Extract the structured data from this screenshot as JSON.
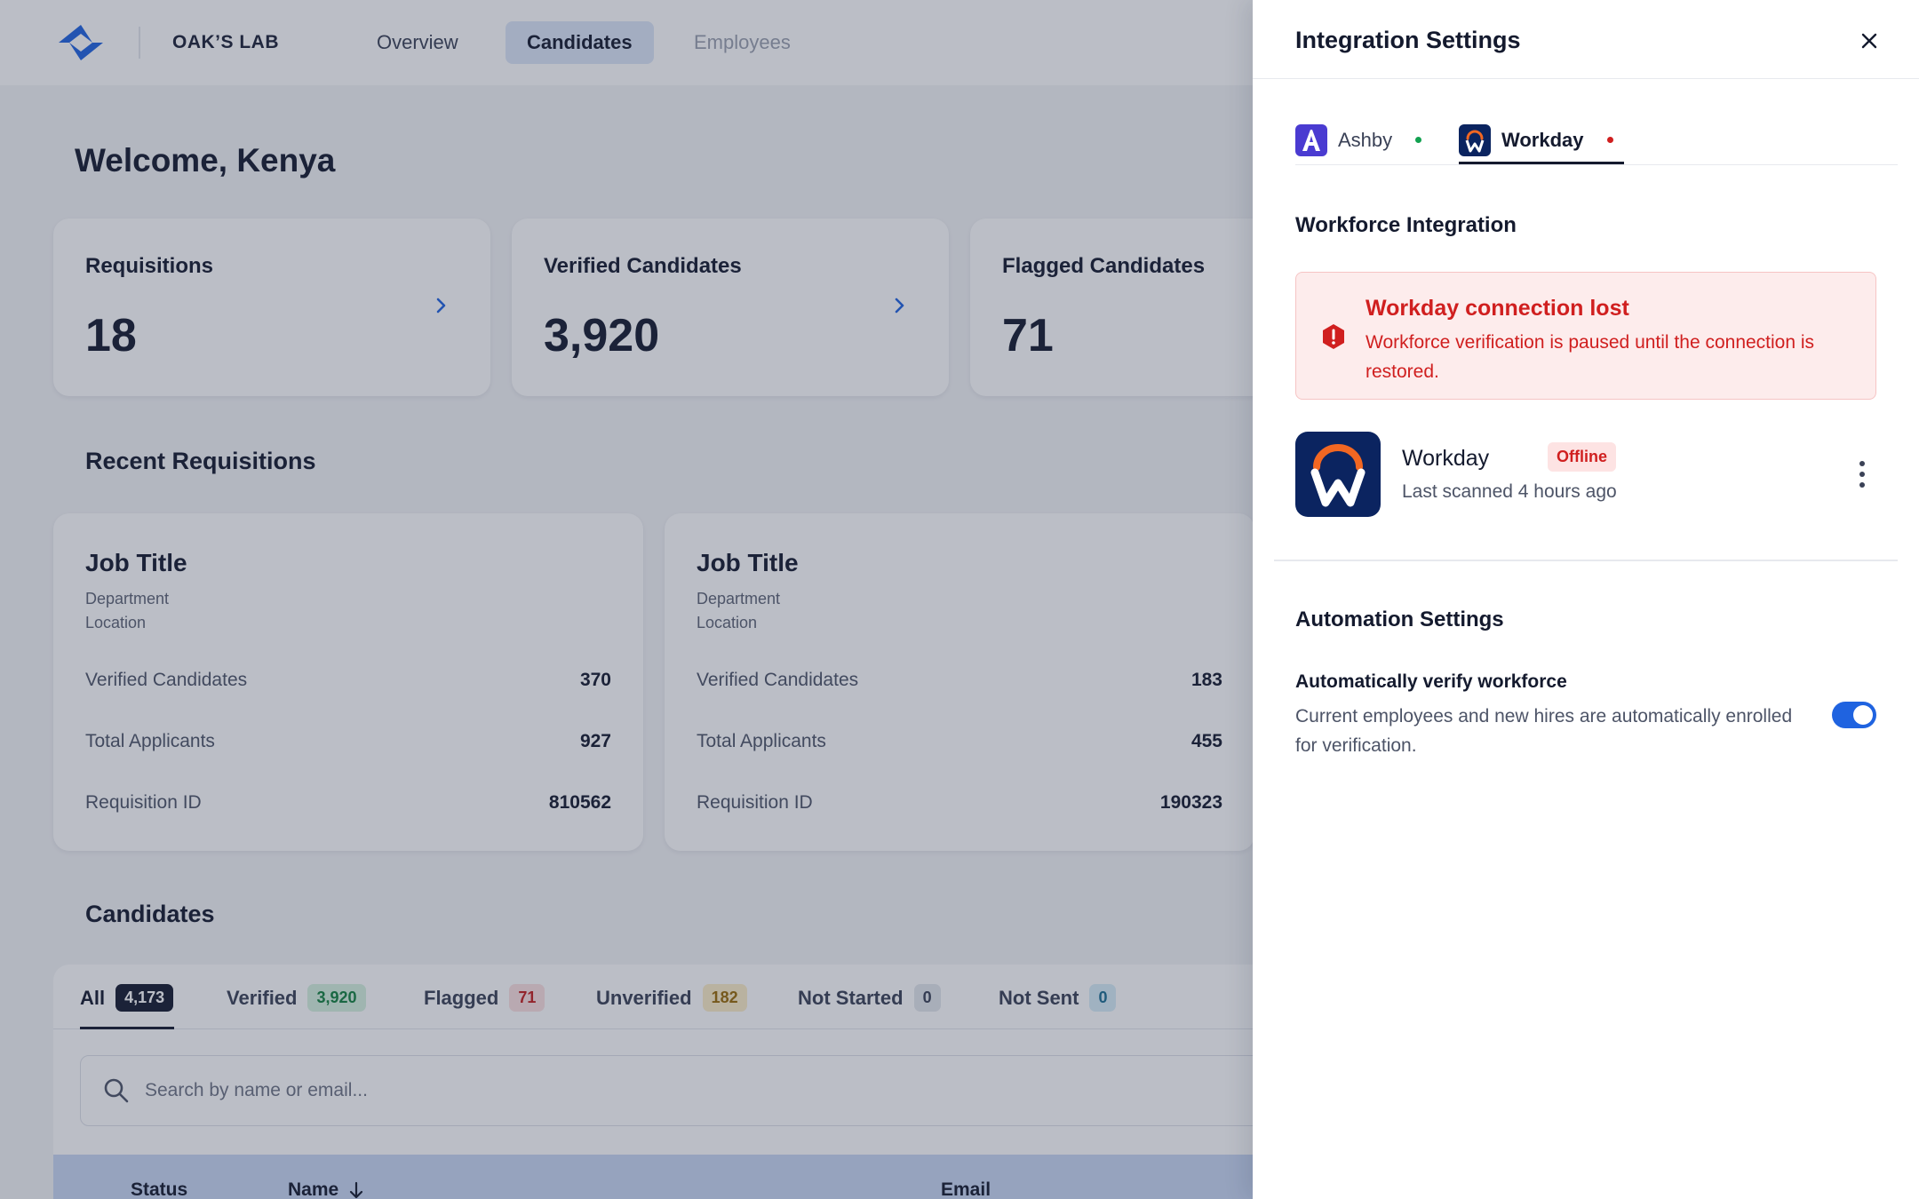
{
  "app": {
    "org_name": "OAK’S LAB",
    "nav": [
      {
        "label": "Overview"
      },
      {
        "label": "Candidates"
      },
      {
        "label": "Employees"
      }
    ],
    "welcome": "Welcome, Kenya",
    "stats": [
      {
        "label": "Requisitions",
        "value": "18"
      },
      {
        "label": "Verified Candidates",
        "value": "3,920"
      },
      {
        "label": "Flagged Candidates",
        "value": "71"
      }
    ],
    "recent_requisitions_title": "Recent Requisitions",
    "requisitions": [
      {
        "job_title": "Job Title",
        "department": "Department",
        "location": "Location",
        "rows": [
          {
            "label": "Verified Candidates",
            "value": "370"
          },
          {
            "label": "Total Applicants",
            "value": "927"
          },
          {
            "label": "Requisition ID",
            "value": "810562"
          }
        ]
      },
      {
        "job_title": "Job Title",
        "department": "Department",
        "location": "Location",
        "rows": [
          {
            "label": "Verified Candidates",
            "value": "183"
          },
          {
            "label": "Total Applicants",
            "value": "455"
          },
          {
            "label": "Requisition ID",
            "value": "190323"
          }
        ]
      }
    ],
    "candidates_title": "Candidates",
    "filter_tabs": [
      {
        "label": "All",
        "count": "4,173"
      },
      {
        "label": "Verified",
        "count": "3,920"
      },
      {
        "label": "Flagged",
        "count": "71"
      },
      {
        "label": "Unverified",
        "count": "182"
      },
      {
        "label": "Not Started",
        "count": "0"
      },
      {
        "label": "Not Sent",
        "count": "0"
      }
    ],
    "search_placeholder": "Search by name or email...",
    "table_headers": {
      "status": "Status",
      "name": "Name",
      "email": "Email"
    }
  },
  "drawer": {
    "title": "Integration Settings",
    "tabs": [
      {
        "label": "Ashby",
        "status_color": "#12a150"
      },
      {
        "label": "Workday",
        "status_color": "#d01f1f"
      }
    ],
    "workforce_title": "Workforce Integration",
    "alert": {
      "title": "Workday connection lost",
      "body": "Workforce verification is paused until the connection is restored."
    },
    "integration": {
      "name": "Workday",
      "status": "Offline",
      "last_scanned": "Last scanned 4 hours ago"
    },
    "automation_title": "Automation Settings",
    "auto_verify": {
      "label": "Automatically verify workforce",
      "description": "Current employees and new hires are automatically enrolled for verification.",
      "enabled": true
    }
  },
  "colors": {
    "accent": "#1f63e0",
    "error": "#d01f1f",
    "success": "#12a150",
    "workday_navy": "#0b2460",
    "workday_orange": "#f26722"
  }
}
